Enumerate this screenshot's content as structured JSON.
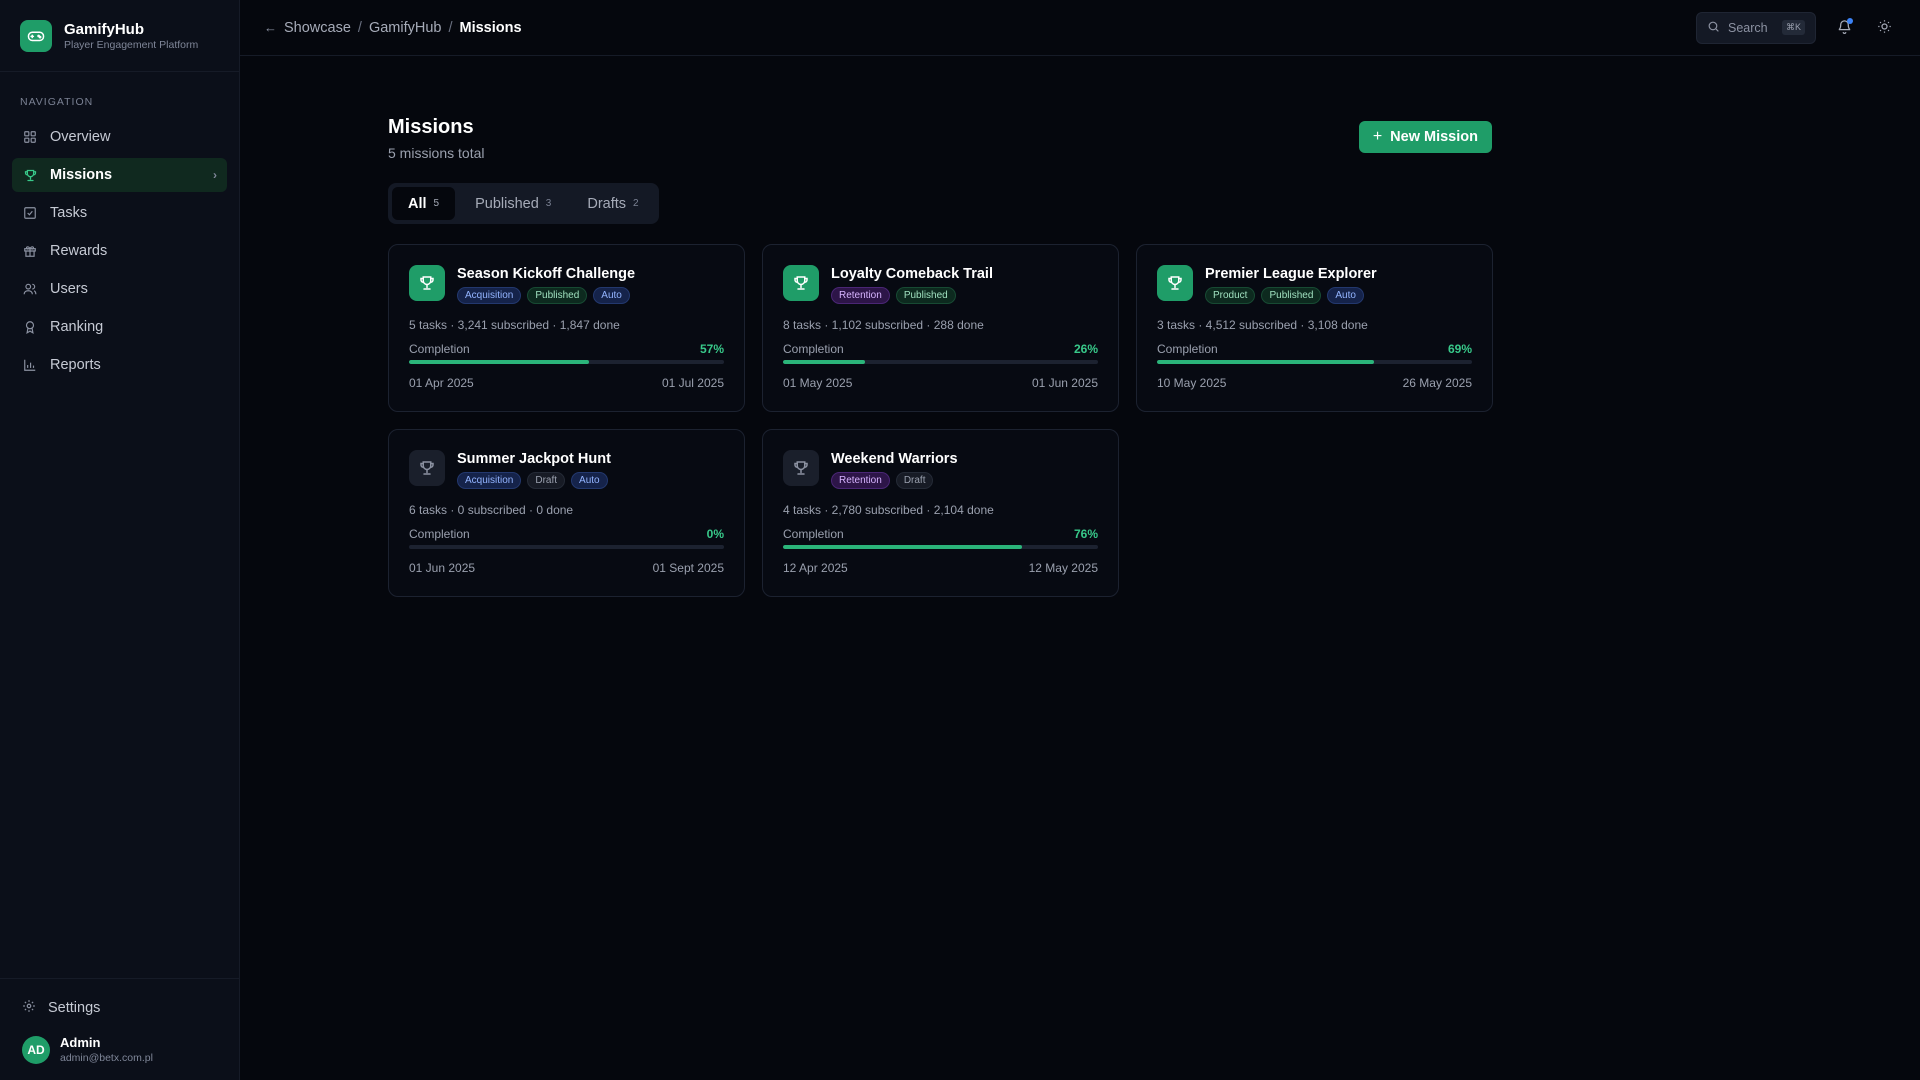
{
  "brand": {
    "name": "GamifyHub",
    "tagline": "Player Engagement Platform"
  },
  "sidebar": {
    "section_label": "NAVIGATION",
    "items": [
      {
        "label": "Overview",
        "icon": "grid-icon"
      },
      {
        "label": "Missions",
        "icon": "trophy-icon",
        "active": true
      },
      {
        "label": "Tasks",
        "icon": "checkbox-icon"
      },
      {
        "label": "Rewards",
        "icon": "gift-icon"
      },
      {
        "label": "Users",
        "icon": "users-icon"
      },
      {
        "label": "Ranking",
        "icon": "medal-icon"
      },
      {
        "label": "Reports",
        "icon": "chart-icon"
      }
    ],
    "settings_label": "Settings",
    "user": {
      "initials": "AD",
      "name": "Admin",
      "email": "admin@betx.com.pl"
    }
  },
  "topbar": {
    "breadcrumb": [
      "Showcase",
      "GamifyHub",
      "Missions"
    ],
    "search_label": "Search",
    "search_shortcut": "⌘K"
  },
  "page": {
    "title": "Missions",
    "subtitle": "5 missions total",
    "new_button_label": "New Mission"
  },
  "tabs": [
    {
      "label": "All",
      "count": "5",
      "active": true
    },
    {
      "label": "Published",
      "count": "3"
    },
    {
      "label": "Drafts",
      "count": "2"
    }
  ],
  "missions": [
    {
      "title": "Season Kickoff Challenge",
      "tags": [
        {
          "text": "Acquisition",
          "color": "blue"
        },
        {
          "text": "Published",
          "color": "green"
        },
        {
          "text": "Auto",
          "color": "blue"
        }
      ],
      "stats": "5 tasks · 3,241 subscribed · 1,847 done",
      "completion_label": "Completion",
      "completion": "57%",
      "progress": 0.57,
      "start": "01 Apr 2025",
      "end": "01 Jul 2025",
      "draft": false
    },
    {
      "title": "Loyalty Comeback Trail",
      "tags": [
        {
          "text": "Retention",
          "color": "purple"
        },
        {
          "text": "Published",
          "color": "green"
        }
      ],
      "stats": "8 tasks · 1,102 subscribed · 288 done",
      "completion_label": "Completion",
      "completion": "26%",
      "progress": 0.26,
      "start": "01 May 2025",
      "end": "01 Jun 2025",
      "draft": false
    },
    {
      "title": "Premier League Explorer",
      "tags": [
        {
          "text": "Product",
          "color": "green"
        },
        {
          "text": "Published",
          "color": "green"
        },
        {
          "text": "Auto",
          "color": "blue"
        }
      ],
      "stats": "3 tasks · 4,512 subscribed · 3,108 done",
      "completion_label": "Completion",
      "completion": "69%",
      "progress": 0.69,
      "start": "10 May 2025",
      "end": "26 May 2025",
      "draft": false
    },
    {
      "title": "Summer Jackpot Hunt",
      "tags": [
        {
          "text": "Acquisition",
          "color": "blue"
        },
        {
          "text": "Draft",
          "color": "gray"
        },
        {
          "text": "Auto",
          "color": "blue"
        }
      ],
      "stats": "6 tasks · 0 subscribed · 0 done",
      "completion_label": "Completion",
      "completion": "0%",
      "progress": 0,
      "start": "01 Jun 2025",
      "end": "01 Sept 2025",
      "draft": true
    },
    {
      "title": "Weekend Warriors",
      "tags": [
        {
          "text": "Retention",
          "color": "purple"
        },
        {
          "text": "Draft",
          "color": "gray"
        }
      ],
      "stats": "4 tasks · 2,780 subscribed · 2,104 done",
      "completion_label": "Completion",
      "completion": "76%",
      "progress": 0.76,
      "start": "12 Apr 2025",
      "end": "12 May 2025",
      "draft": true
    }
  ],
  "colors": {
    "accent": "#1f9d68",
    "background": "#05070d",
    "sidebar": "#0b0f19"
  }
}
